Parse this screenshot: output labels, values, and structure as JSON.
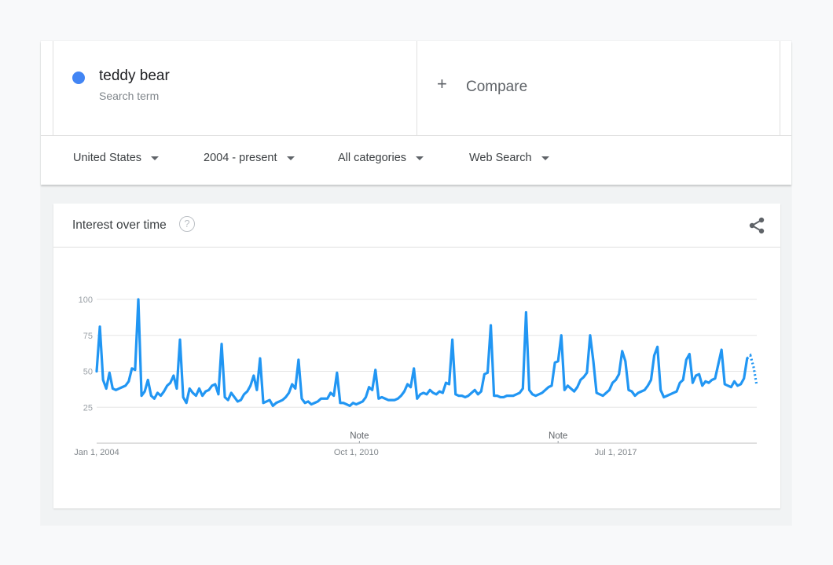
{
  "term": {
    "name": "teddy bear",
    "type": "Search term",
    "color": "#4285f4"
  },
  "compare": {
    "icon": "plus-icon",
    "plus": "+",
    "label": "Compare"
  },
  "filters": [
    {
      "label": "United States"
    },
    {
      "label": "2004 - present"
    },
    {
      "label": "All categories"
    },
    {
      "label": "Web Search"
    }
  ],
  "interest_card": {
    "title": "Interest over time",
    "help_icon": "help-circle-icon",
    "help_symbol": "?",
    "share_icon": "share-icon"
  },
  "chart_data": {
    "type": "line",
    "title": "",
    "xlabel": "",
    "ylabel": "",
    "x_ticks": [
      "Jan 1, 2004",
      "Oct 1, 2010",
      "Jul 1, 2017"
    ],
    "y_ticks": [
      25,
      50,
      75,
      100
    ],
    "ylim": [
      0,
      100
    ],
    "grid": true,
    "annotations": [
      {
        "label": "Note",
        "month": 82
      },
      {
        "label": "Note",
        "month": 144
      }
    ],
    "series_color": "#2196f3",
    "series": [
      {
        "name": "teddy bear",
        "x_start": "2004-01",
        "x_step": "1 month",
        "partial_last_points": 3,
        "values": [
          50,
          81,
          44,
          38,
          49,
          38,
          37,
          38,
          39,
          40,
          43,
          52,
          51,
          100,
          33,
          36,
          44,
          33,
          31,
          35,
          33,
          36,
          40,
          42,
          47,
          38,
          72,
          32,
          28,
          38,
          35,
          33,
          38,
          33,
          36,
          37,
          40,
          41,
          34,
          69,
          32,
          30,
          35,
          32,
          29,
          30,
          34,
          36,
          40,
          47,
          37,
          59,
          28,
          29,
          30,
          26,
          28,
          29,
          30,
          32,
          35,
          41,
          38,
          58,
          31,
          28,
          29,
          27,
          28,
          29,
          31,
          31,
          31,
          35,
          33,
          49,
          28,
          28,
          27,
          26,
          28,
          27,
          28,
          29,
          32,
          39,
          37,
          51,
          31,
          32,
          31,
          30,
          30,
          30,
          31,
          33,
          36,
          41,
          39,
          52,
          31,
          34,
          35,
          34,
          37,
          35,
          34,
          36,
          35,
          42,
          41,
          72,
          34,
          33,
          33,
          32,
          33,
          35,
          37,
          34,
          36,
          48,
          49,
          82,
          33,
          33,
          32,
          32,
          33,
          33,
          33,
          34,
          35,
          38,
          91,
          37,
          34,
          33,
          34,
          35,
          37,
          39,
          40,
          56,
          57,
          75,
          37,
          40,
          38,
          36,
          39,
          44,
          46,
          49,
          75,
          57,
          35,
          34,
          33,
          35,
          37,
          42,
          44,
          48,
          64,
          57,
          37,
          36,
          33,
          35,
          36,
          37,
          40,
          44,
          61,
          67,
          37,
          32,
          33,
          34,
          35,
          36,
          42,
          44,
          58,
          62,
          42,
          47,
          48,
          40,
          43,
          42,
          44,
          45,
          55,
          65,
          41,
          40,
          39,
          43,
          40,
          41,
          45,
          59,
          61,
          53,
          40
        ]
      }
    ]
  }
}
